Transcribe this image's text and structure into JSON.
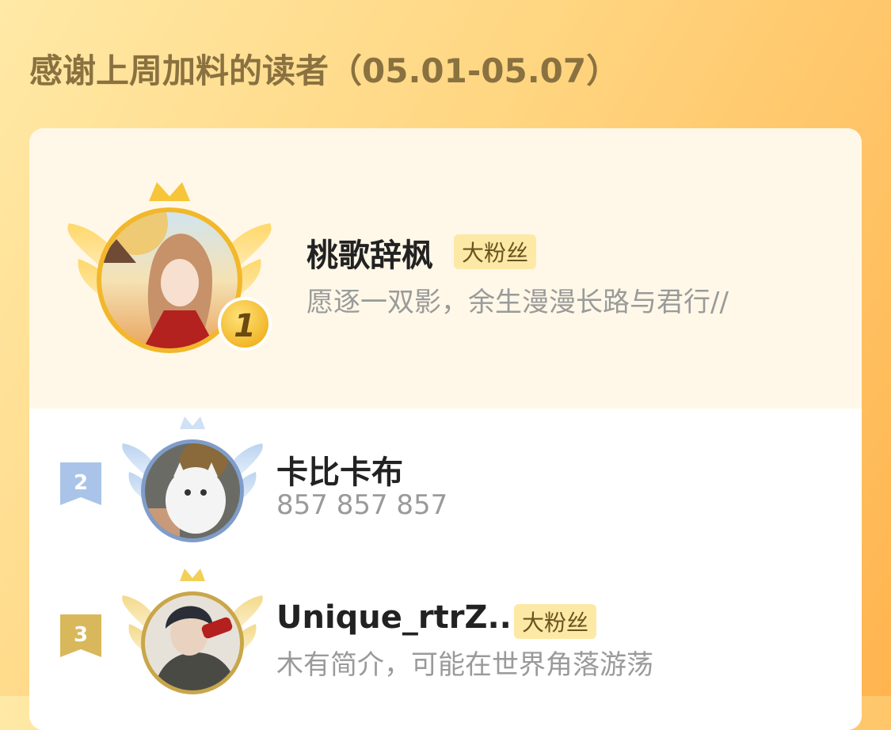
{
  "header": {
    "title": "感谢上周加料的读者（05.01-05.07）"
  },
  "readers": [
    {
      "rank": "1",
      "name": "桃歌辞枫",
      "badge": "大粉丝",
      "bio": "愿逐一双影，余生漫漫长路与君行//"
    },
    {
      "rank": "2",
      "name": "卡比卡布",
      "bio": "857 857 857"
    },
    {
      "rank": "3",
      "name": "Unique_rtrZ...",
      "badge": "大粉丝",
      "bio": "木有简介，可能在世界角落游荡"
    }
  ],
  "colors": {
    "gold": "#f2b72a",
    "silver": "#a9c4e8",
    "bronze": "#d9b85c",
    "title_brown": "#8a7140"
  }
}
